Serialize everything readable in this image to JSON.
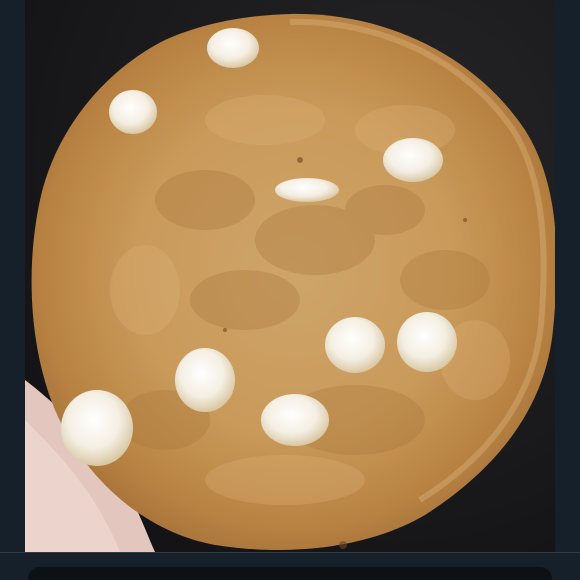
{
  "photo": {
    "subject": "cookie-photo",
    "colors": {
      "background": "#15202b",
      "photo_backdrop": "#1b1b1e",
      "cookie_base": "#c99a5a",
      "cookie_edge": "#b47d3f",
      "chip": "#f6f1e6",
      "hand": "#e3c6bd"
    }
  },
  "composer": {
    "colors": {
      "pill": "#0c1116"
    }
  }
}
